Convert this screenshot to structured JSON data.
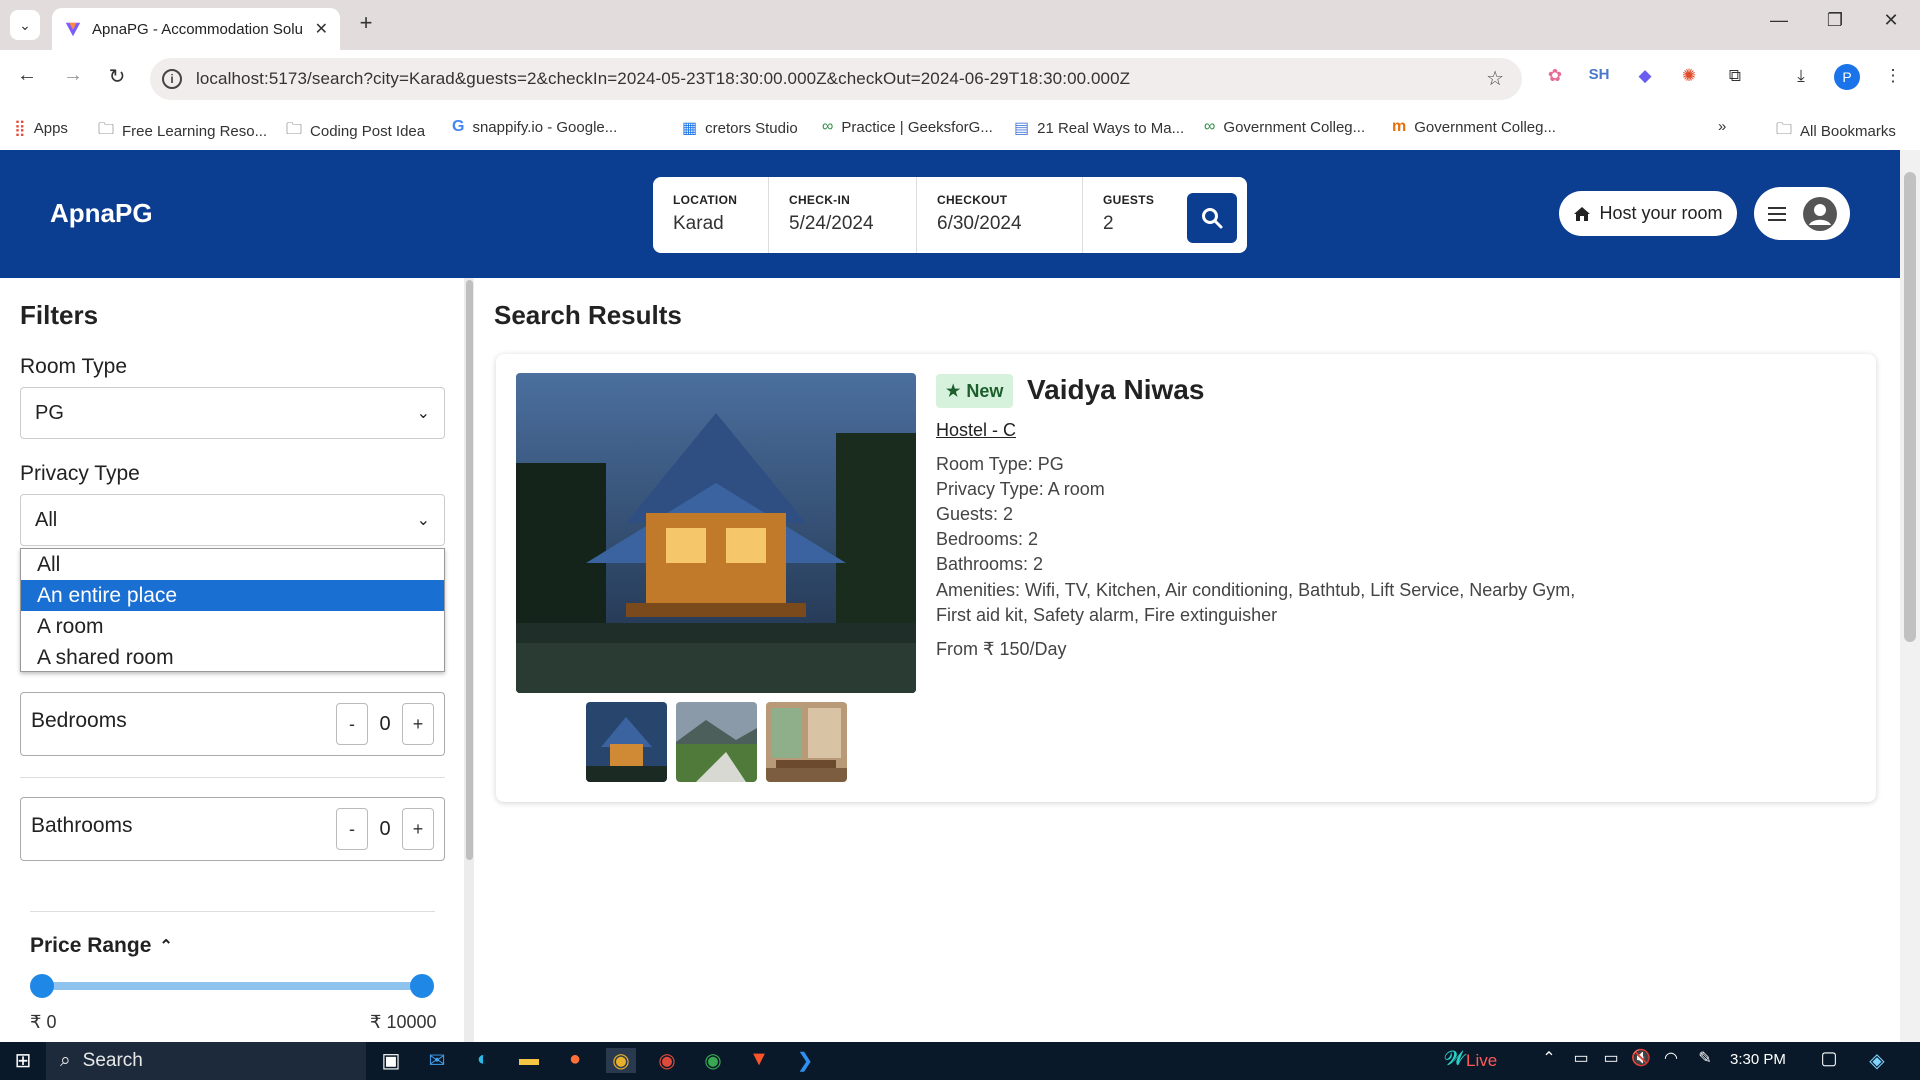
{
  "browser": {
    "tab_title": "ApnaPG - Accommodation Solu",
    "url": "localhost:5173/search?city=Karad&guests=2&checkIn=2024-05-23T18:30:00.000Z&checkOut=2024-06-29T18:30:00.000Z",
    "bookmarks": [
      "Apps",
      "Free Learning Reso...",
      "Coding Post Idea",
      "snappify.io - Google...",
      "cretors Studio",
      "Practice | GeeksforG...",
      "21 Real Ways to Ma...",
      "Government Colleg...",
      "Government Colleg...",
      "All Bookmarks"
    ],
    "extensions": [
      "SH",
      "P"
    ]
  },
  "header": {
    "brand": "ApnaPG",
    "search": {
      "location_label": "LOCATION",
      "location_value": "Karad",
      "checkin_label": "CHECK-IN",
      "checkin_value": "5/24/2024",
      "checkout_label": "CHECKOUT",
      "checkout_value": "6/30/2024",
      "guests_label": "GUESTS",
      "guests_value": "2"
    },
    "host_button": "Host your room"
  },
  "filters": {
    "title": "Filters",
    "room_type_label": "Room Type",
    "room_type_value": "PG",
    "privacy_label": "Privacy Type",
    "privacy_value": "All",
    "privacy_options": [
      "All",
      "An entire place",
      "A room",
      "A shared room"
    ],
    "bedrooms_label": "Bedrooms",
    "bedrooms_value": "0",
    "bathrooms_label": "Bathrooms",
    "bathrooms_value": "0",
    "minus": "-",
    "plus": "+",
    "price_title": "Price Range",
    "price_min": "₹ 0",
    "price_max": "₹ 10000"
  },
  "results": {
    "title": "Search Results",
    "card": {
      "badge": "New",
      "name": "Vaidya Niwas",
      "subtitle": "Hostel - C",
      "room_type": "Room Type: PG",
      "privacy_type": "Privacy Type: A room",
      "guests": "Guests: 2",
      "bedrooms": "Bedrooms: 2",
      "bathrooms": "Bathrooms: 2",
      "amenities": "Amenities: Wifi, TV, Kitchen, Air conditioning, Bathtub, Lift Service, Nearby Gym, First aid kit, Safety alarm, Fire extinguisher",
      "price": "From ₹ 150/Day"
    }
  },
  "taskbar": {
    "search": "Search",
    "live": "Live",
    "time": "3:30 PM"
  }
}
